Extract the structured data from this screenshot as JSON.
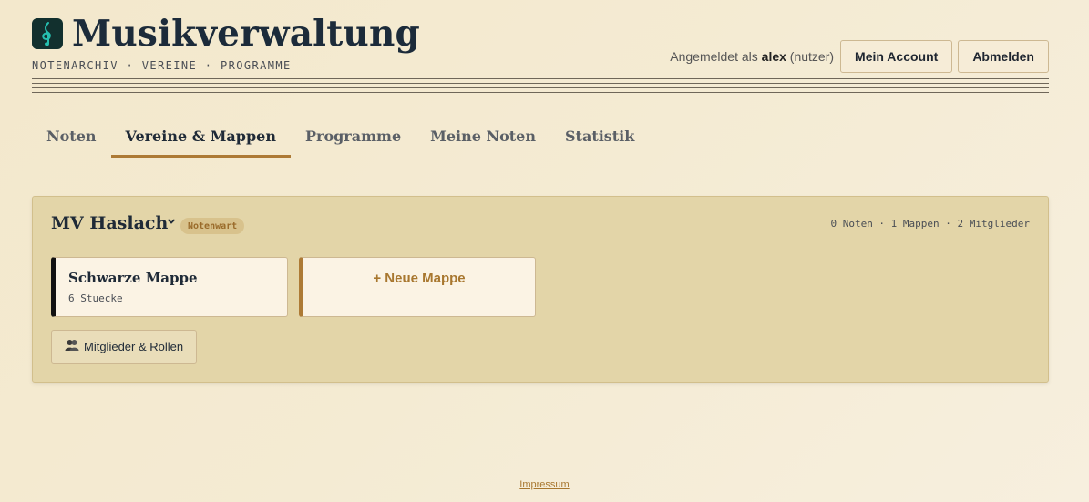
{
  "app": {
    "title": "Musikverwaltung",
    "subtitle": "NOTENARCHIV · VEREINE · PROGRAMME",
    "logo_icon": "treble-clef-icon"
  },
  "user": {
    "prefix": "Angemeldet als ",
    "name": "alex",
    "role": " (nutzer)",
    "account_label": "Mein Account",
    "logout_label": "Abmelden"
  },
  "tabs": [
    {
      "label": "Noten",
      "active": false
    },
    {
      "label": "Vereine & Mappen",
      "active": true
    },
    {
      "label": "Programme",
      "active": false
    },
    {
      "label": "Meine Noten",
      "active": false
    },
    {
      "label": "Statistik",
      "active": false
    }
  ],
  "club": {
    "name": "MV Haslach",
    "role_badge": "Notenwart",
    "stats": "0 Noten · 1 Mappen · 2 Mitglieder",
    "folders": [
      {
        "title": "Schwarze Mappe",
        "count": "6 Stuecke",
        "color": "#111111"
      }
    ],
    "new_folder_label": "+ Neue Mappe",
    "members_label": "Mitglieder & Rollen"
  },
  "footer": {
    "impressum": "Impressum"
  },
  "colors": {
    "accent": "#ad7a35",
    "text_dark": "#1f2a37",
    "panel_bg": "#e3d5a8"
  }
}
